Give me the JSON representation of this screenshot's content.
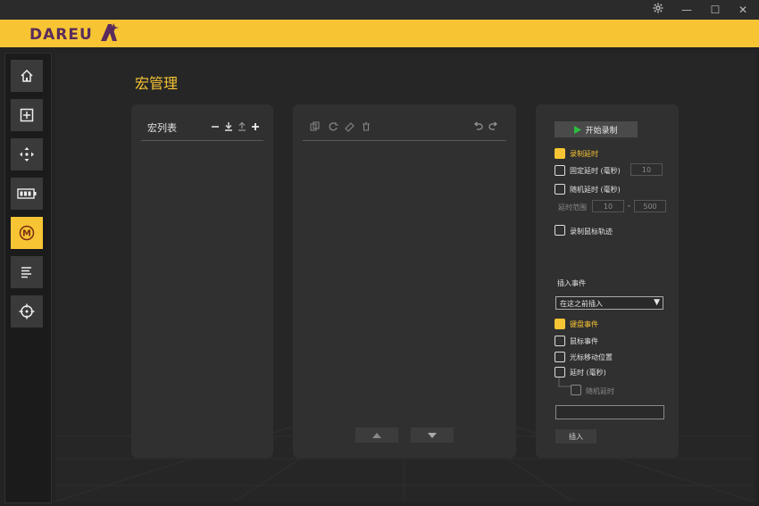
{
  "window": {
    "settings_icon": "gear-icon",
    "minimize": "—",
    "maximize": "☐",
    "close": "✕"
  },
  "brand": {
    "name": "DAREU",
    "accent": "#f7c534",
    "logo_color": "#5a2c5c"
  },
  "sidebar": {
    "items": [
      {
        "icon": "home-icon"
      },
      {
        "icon": "plus-box-icon"
      },
      {
        "icon": "move-arrows-icon"
      },
      {
        "icon": "battery-icon"
      },
      {
        "icon": "macro-m-icon",
        "active": true
      },
      {
        "icon": "lines-icon"
      },
      {
        "icon": "crosshair-icon"
      }
    ]
  },
  "page": {
    "title": "宏管理"
  },
  "macro_list": {
    "title": "宏列表"
  },
  "recording": {
    "start_label": "开始录制",
    "record_delay": "录制延时",
    "fixed_delay": "固定延时 (毫秒)",
    "fixed_delay_value": "10",
    "random_delay": "随机延时 (毫秒)",
    "delay_range": "延时范围",
    "range_min": "10",
    "range_sep": "-",
    "range_max": "500",
    "record_mouse_track": "录制鼠标轨迹"
  },
  "insert": {
    "section_title": "插入事件",
    "position_selected": "在这之前插入",
    "keyboard_event": "键盘事件",
    "mouse_event": "鼠标事件",
    "cursor_move": "光标移动位置",
    "delay_ms": "延时 (毫秒)",
    "random_delay": "随机延时",
    "insert_button": "插入"
  }
}
